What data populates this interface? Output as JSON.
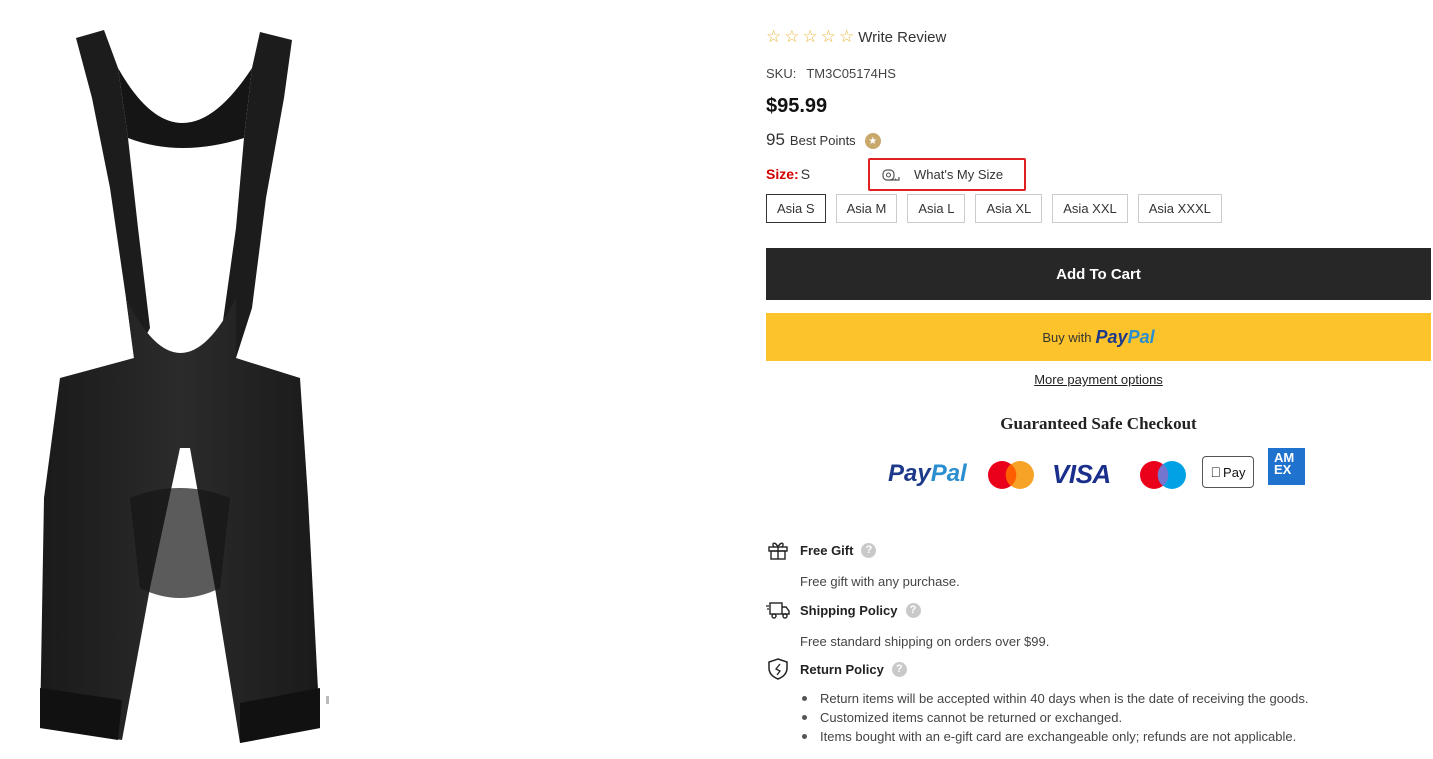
{
  "product": {
    "rating_stars": 5,
    "write_review": "Write Review",
    "sku_label": "SKU:",
    "sku_value": "TM3C05174HS",
    "price": "$95.99",
    "points_number": "95",
    "points_label": "Best Points",
    "size_label": "Size:",
    "size_value": "S",
    "whats_my_size": "What's My Size",
    "sizes": [
      "Asia S",
      "Asia M",
      "Asia L",
      "Asia XL",
      "Asia XXL",
      "Asia XXXL"
    ],
    "selected_size": "Asia S"
  },
  "actions": {
    "add_to_cart": "Add To Cart",
    "buy_with": "Buy with",
    "paypal_pay": "Pay",
    "paypal_pal": "Pal",
    "more_payment": "More payment options"
  },
  "checkout": {
    "title": "Guaranteed Safe Checkout",
    "logos": [
      "paypal",
      "mastercard",
      "visa",
      "maestro",
      "apple-pay",
      "amex"
    ],
    "paypal_pay": "Pay",
    "paypal_pal": "Pal",
    "visa": "VISA",
    "apple_pay": "Pay",
    "amex": "AM EX"
  },
  "policies": {
    "gift": {
      "title": "Free Gift",
      "desc": "Free gift with any purchase."
    },
    "shipping": {
      "title": "Shipping Policy",
      "desc": "Free standard shipping on orders over $99."
    },
    "returns": {
      "title": "Return Policy",
      "items": [
        "Return items will be accepted within 40 days when is the date of receiving the goods.",
        "Customized items cannot be returned or exchanged.",
        "Items bought with an e-gift card are exchangeable only; refunds are not applicable."
      ]
    },
    "help_glyph": "?"
  },
  "colors": {
    "add_to_cart_bg": "#272727",
    "paypal_button_bg": "#fcc42a",
    "size_label": "#d40000",
    "highlight_border": "#e02020",
    "star": "#e9b73a"
  }
}
